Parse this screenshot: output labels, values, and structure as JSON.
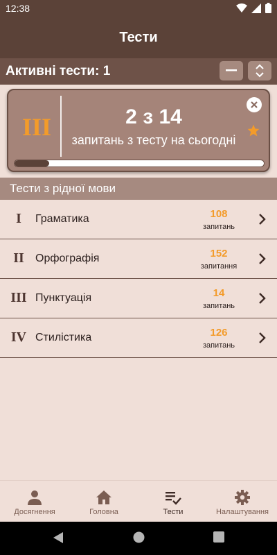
{
  "status_bar": {
    "time": "12:38"
  },
  "app_bar": {
    "title": "Тести"
  },
  "active_tests": {
    "label": "Активні тести: 1"
  },
  "current_test": {
    "roman": "III",
    "progress_text": "2 з 14",
    "subtitle": "запитань з тесту на сьогодні",
    "progress_fraction": 0.14
  },
  "section": {
    "title": "Тести з рідної мови"
  },
  "tests": [
    {
      "roman": "I",
      "name": "Граматика",
      "count": "108",
      "unit": "запитань"
    },
    {
      "roman": "II",
      "name": "Орфографія",
      "count": "152",
      "unit": "запитання"
    },
    {
      "roman": "III",
      "name": "Пунктуація",
      "count": "14",
      "unit": "запитань"
    },
    {
      "roman": "IV",
      "name": "Стилістика",
      "count": "126",
      "unit": "запитань"
    }
  ],
  "bottom_nav": [
    {
      "label": "Досягнення",
      "icon": "person-icon"
    },
    {
      "label": "Головна",
      "icon": "home-icon"
    },
    {
      "label": "Тести",
      "icon": "checklist-icon",
      "active": true
    },
    {
      "label": "Налаштування",
      "icon": "gear-icon"
    }
  ],
  "colors": {
    "app_bar": "#5b4238",
    "background": "#f0dfd8",
    "accent": "#f39b2a",
    "card": "#a58479"
  }
}
